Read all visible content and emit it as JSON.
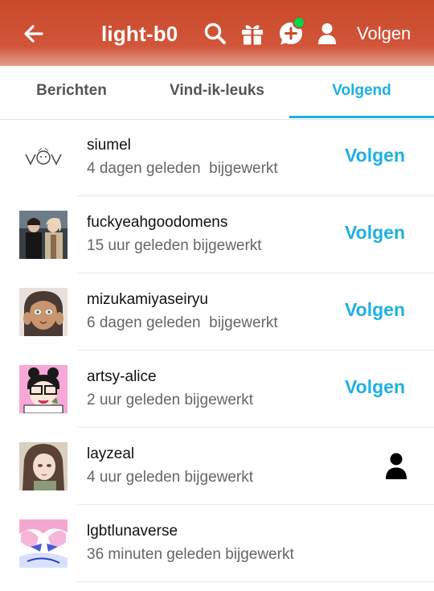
{
  "header": {
    "title": "light-b0",
    "follow_label": "Volgen",
    "icons": [
      "back-arrow-icon",
      "search-icon",
      "gift-icon",
      "chat-icon",
      "person-icon"
    ],
    "notification_dot_color": "#00d34c",
    "background_color": "#c84a2a"
  },
  "tabs": [
    {
      "label": "Berichten",
      "active": false
    },
    {
      "label": "Vind-ik-leuks",
      "active": false
    },
    {
      "label": "Volgend",
      "active": true
    }
  ],
  "accent_color": "#1bb0e0",
  "list": [
    {
      "name": "siumel",
      "updated": "4 dagen geleden  bijgewerkt",
      "action": "Volgen"
    },
    {
      "name": "fuckyeahgoodomens",
      "updated": "15 uur geleden bijgewerkt",
      "action": "Volgen"
    },
    {
      "name": "mizukamiyaseiryu",
      "updated": "6 dagen geleden  bijgewerkt",
      "action": "Volgen"
    },
    {
      "name": "artsy-alice",
      "updated": "2 uur geleden bijgewerkt",
      "action": "Volgen"
    },
    {
      "name": "layzeal",
      "updated": "4 uur geleden bijgewerkt",
      "action": "person-icon"
    },
    {
      "name": "lgbtlunaverse",
      "updated": "36 minuten geleden bijgewerkt",
      "action": ""
    }
  ]
}
